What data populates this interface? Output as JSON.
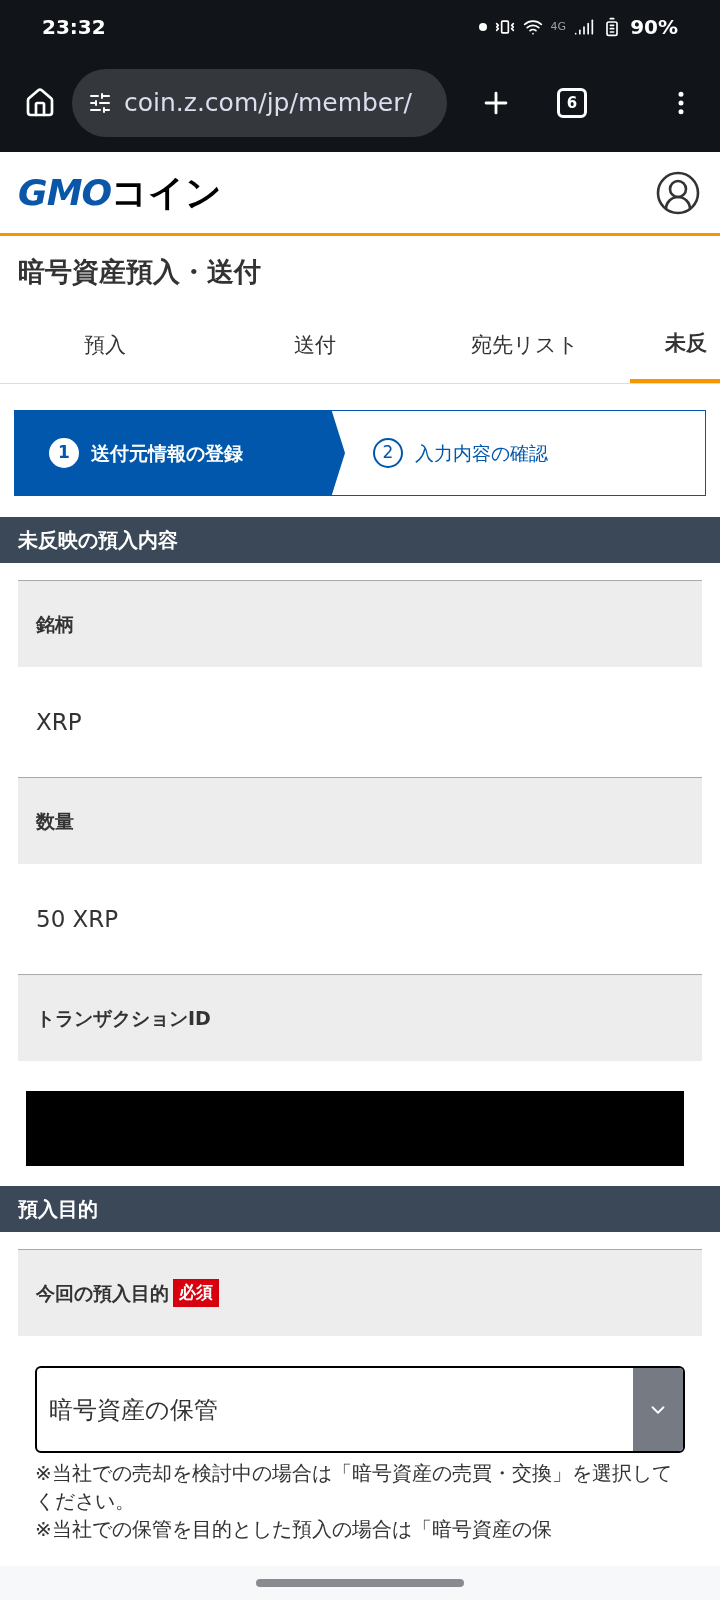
{
  "status_bar": {
    "time": "23:32",
    "network": "4G",
    "battery": "90%"
  },
  "browser": {
    "url": "coin.z.com/jp/member/",
    "tab_count": "6"
  },
  "header": {
    "logo_latin": "GMO",
    "logo_kana": "コイン"
  },
  "page_title": "暗号資産預入・送付",
  "tabs": [
    {
      "label": "預入",
      "selected": false
    },
    {
      "label": "送付",
      "selected": false
    },
    {
      "label": "宛先リスト",
      "selected": false
    },
    {
      "label": "未反",
      "selected": true
    }
  ],
  "steps": [
    {
      "number": "1",
      "label": "送付元情報の登録",
      "selected": true
    },
    {
      "number": "2",
      "label": "入力内容の確認",
      "selected": false
    }
  ],
  "sections": [
    {
      "title": "未反映の預入内容",
      "fields": [
        {
          "kind": "text",
          "label": "銘柄",
          "value": "XRP"
        },
        {
          "kind": "text",
          "label": "数量",
          "value": "50 XRP"
        },
        {
          "kind": "redacted",
          "label": "トランザクションID"
        }
      ]
    },
    {
      "title": "預入目的",
      "fields": [
        {
          "kind": "select",
          "label": "今回の預入目的",
          "required": "必須",
          "value": "暗号資産の保管"
        }
      ]
    }
  ],
  "notes": [
    "※当社での売却を検討中の場合は「暗号資産の売買・交換」を選択してください。",
    "※当社での保管を目的とした預入の場合は「暗号資産の保"
  ]
}
